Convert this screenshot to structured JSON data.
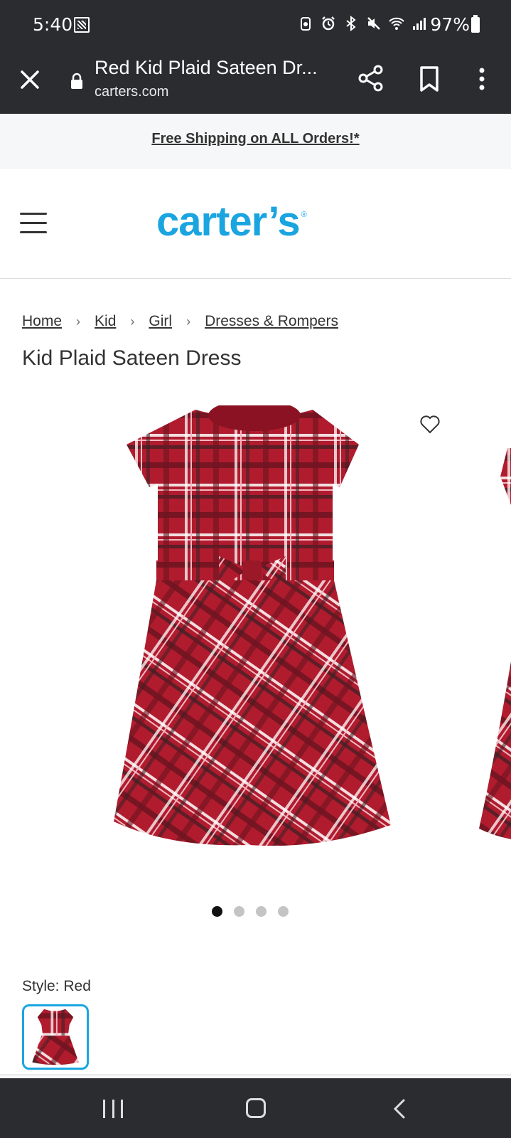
{
  "status_bar": {
    "time": "5:40",
    "battery": "97%",
    "icons": [
      "gallery-icon",
      "lock-screen-icon",
      "alarm-icon",
      "bluetooth-icon",
      "mute-icon",
      "wifi-icon",
      "signal-icon",
      "battery-icon"
    ]
  },
  "browser": {
    "page_title": "Red Kid Plaid Sateen Dr...",
    "domain": "carters.com"
  },
  "promo": {
    "text": "Free Shipping on ALL Orders!*"
  },
  "header": {
    "logo_text": "carter’s",
    "logo_mark": "®",
    "brand_color": "#1aa5e0"
  },
  "breadcrumb": [
    "Home",
    "Kid",
    "Girl",
    "Dresses & Rompers"
  ],
  "product": {
    "title": "Kid Plaid Sateen Dress",
    "image_count": 4,
    "active_image": 1,
    "style_label": "Style:",
    "style_value": "Red",
    "primary_color": "#b01c2e"
  }
}
